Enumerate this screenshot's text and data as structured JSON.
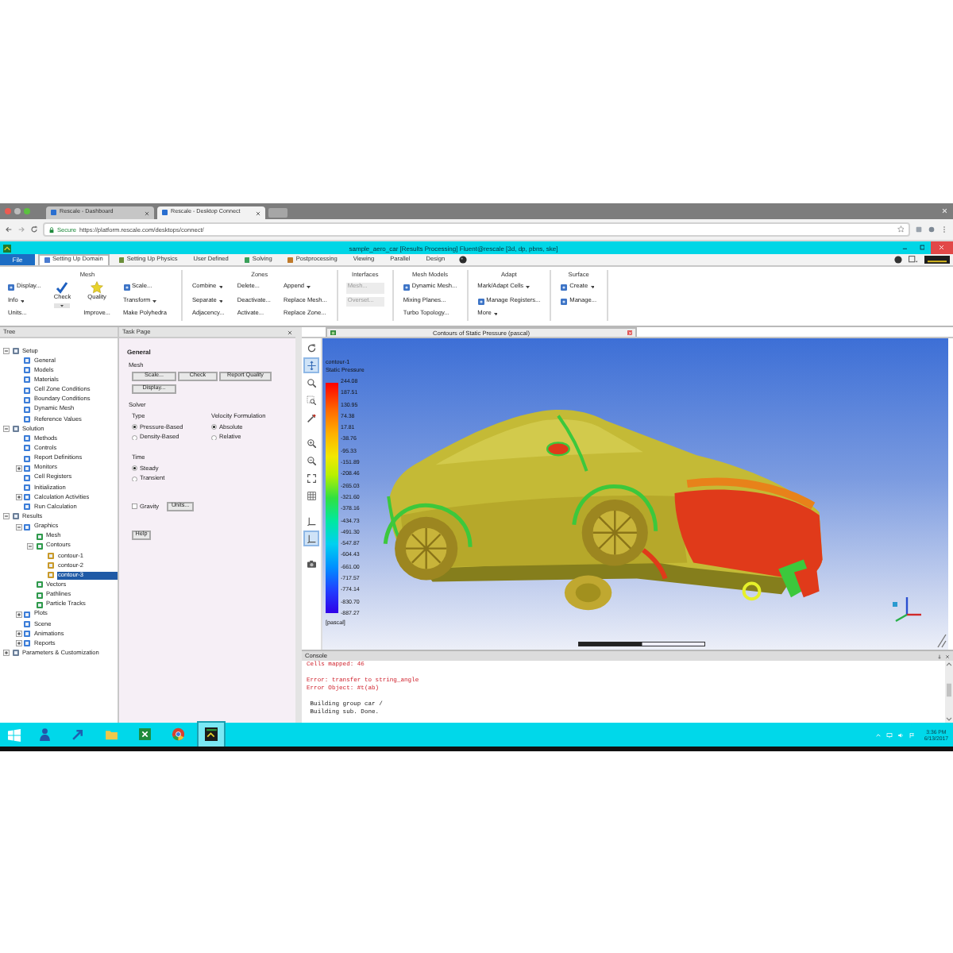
{
  "browser": {
    "tabs": [
      {
        "label": "Rescale - Dashboard",
        "selected": false
      },
      {
        "label": "Rescale - Desktop Connect",
        "selected": true
      }
    ],
    "secure_label": "Secure",
    "url": "https://platform.rescale.com/desktops/connect/"
  },
  "window": {
    "title": "sample_aero_car [Results Processing] Fluent@rescale [3d, dp, pbns, ske]"
  },
  "ribbon": {
    "file_label": "File",
    "tabs": [
      {
        "label": "Setting Up Domain",
        "kind": "icon",
        "selected": true
      },
      {
        "label": "Setting Up Physics",
        "kind": "icon",
        "selected": false
      },
      {
        "label": "User Defined",
        "kind": "plain",
        "selected": false
      },
      {
        "label": "Solving",
        "kind": "icon",
        "selected": false
      },
      {
        "label": "Postprocessing",
        "kind": "icon",
        "selected": false
      },
      {
        "label": "Viewing",
        "kind": "plain",
        "selected": false
      },
      {
        "label": "Parallel",
        "kind": "plain",
        "selected": false
      },
      {
        "label": "Design",
        "kind": "plain",
        "selected": false
      }
    ],
    "groups": [
      {
        "title": "Mesh",
        "columns": [
          [
            {
              "label": "Display...",
              "kind": "small",
              "menu": false,
              "disabled": false
            },
            {
              "label": "Info",
              "kind": "text",
              "menu": true,
              "disabled": false
            },
            {
              "label": "Units...",
              "kind": "text",
              "menu": false,
              "disabled": false
            }
          ],
          [
            {
              "label": "Check",
              "kind": "big",
              "menu": true,
              "disabled": false
            }
          ],
          [
            {
              "label": "Quality",
              "kind": "big",
              "menu": false,
              "disabled": false
            },
            {
              "label": "Improve...",
              "kind": "text",
              "menu": false,
              "disabled": false
            }
          ],
          [
            {
              "label": "Scale...",
              "kind": "small",
              "menu": false,
              "disabled": false
            },
            {
              "label": "Transform",
              "kind": "text",
              "menu": true,
              "disabled": false
            },
            {
              "label": "Make Polyhedra",
              "kind": "text",
              "menu": false,
              "disabled": false
            }
          ]
        ]
      },
      {
        "title": "Zones",
        "columns": [
          [
            {
              "label": "Combine",
              "kind": "text",
              "menu": true,
              "disabled": false
            },
            {
              "label": "Separate",
              "kind": "text",
              "menu": true,
              "disabled": false
            },
            {
              "label": "Adjacency...",
              "kind": "text",
              "menu": false,
              "disabled": false
            }
          ],
          [
            {
              "label": "Delete...",
              "kind": "text",
              "menu": false,
              "disabled": false
            },
            {
              "label": "Deactivate...",
              "kind": "text",
              "menu": false,
              "disabled": false
            },
            {
              "label": "Activate...",
              "kind": "text",
              "menu": false,
              "disabled": false
            }
          ],
          [
            {
              "label": "Append",
              "kind": "text",
              "menu": true,
              "disabled": false
            },
            {
              "label": "Replace Mesh...",
              "kind": "text",
              "menu": false,
              "disabled": false
            },
            {
              "label": "Replace Zone...",
              "kind": "text",
              "menu": false,
              "disabled": false
            }
          ]
        ]
      },
      {
        "title": "Interfaces",
        "columns": [
          [
            {
              "label": "Mesh...",
              "kind": "text",
              "menu": false,
              "disabled": true
            },
            {
              "label": "Overset...",
              "kind": "text",
              "menu": false,
              "disabled": true
            }
          ]
        ]
      },
      {
        "title": "Mesh Models",
        "columns": [
          [
            {
              "label": "Dynamic Mesh...",
              "kind": "small",
              "menu": false,
              "disabled": false
            },
            {
              "label": "Mixing Planes...",
              "kind": "text",
              "menu": false,
              "disabled": false
            },
            {
              "label": "Turbo Topology...",
              "kind": "text",
              "menu": false,
              "disabled": false
            }
          ]
        ]
      },
      {
        "title": "Adapt",
        "columns": [
          [
            {
              "label": "Mark/Adapt Cells",
              "kind": "text",
              "menu": true,
              "disabled": false
            },
            {
              "label": "Manage Registers...",
              "kind": "small",
              "menu": false,
              "disabled": false
            },
            {
              "label": "More",
              "kind": "text",
              "menu": true,
              "disabled": false
            }
          ]
        ]
      },
      {
        "title": "Surface",
        "columns": [
          [
            {
              "label": "Create",
              "kind": "small",
              "menu": true,
              "disabled": false
            },
            {
              "label": "Manage...",
              "kind": "small",
              "menu": false,
              "disabled": false
            }
          ]
        ]
      }
    ]
  },
  "tree": {
    "title": "Tree",
    "items": [
      {
        "label": "Setup",
        "expanded": true,
        "selected": false,
        "children": [
          {
            "label": "General",
            "selected": false
          },
          {
            "label": "Models",
            "selected": false
          },
          {
            "label": "Materials",
            "selected": false
          },
          {
            "label": "Cell Zone Conditions",
            "selected": false
          },
          {
            "label": "Boundary Conditions",
            "selected": false
          },
          {
            "label": "Dynamic Mesh",
            "selected": false
          },
          {
            "label": "Reference Values",
            "selected": false
          }
        ]
      },
      {
        "label": "Solution",
        "expanded": true,
        "selected": false,
        "children": [
          {
            "label": "Methods",
            "selected": false
          },
          {
            "label": "Controls",
            "selected": false
          },
          {
            "label": "Report Definitions",
            "selected": false
          },
          {
            "label": "Monitors",
            "expanded": false,
            "selected": false
          },
          {
            "label": "Cell Registers",
            "selected": false
          },
          {
            "label": "Initialization",
            "selected": false
          },
          {
            "label": "Calculation Activities",
            "expanded": false,
            "selected": false
          },
          {
            "label": "Run Calculation",
            "selected": false
          }
        ]
      },
      {
        "label": "Results",
        "expanded": true,
        "selected": false,
        "children": [
          {
            "label": "Graphics",
            "expanded": true,
            "selected": false,
            "children": [
              {
                "label": "Mesh",
                "selected": false
              },
              {
                "label": "Contours",
                "expanded": true,
                "selected": false,
                "children": [
                  {
                    "label": "contour-1",
                    "selected": false
                  },
                  {
                    "label": "contour-2",
                    "selected": false
                  },
                  {
                    "label": "contour-3",
                    "selected": true
                  }
                ]
              },
              {
                "label": "Vectors",
                "selected": false
              },
              {
                "label": "Pathlines",
                "selected": false
              },
              {
                "label": "Particle Tracks",
                "selected": false
              }
            ]
          },
          {
            "label": "Plots",
            "expanded": false,
            "selected": false
          },
          {
            "label": "Scene",
            "selected": false
          },
          {
            "label": "Animations",
            "expanded": false,
            "selected": false
          },
          {
            "label": "Reports",
            "expanded": false,
            "selected": false
          }
        ]
      },
      {
        "label": "Parameters & Customization",
        "expanded": false,
        "selected": false
      }
    ]
  },
  "task_page": {
    "title": "Task Page",
    "heading": "General",
    "mesh": {
      "label": "Mesh",
      "buttons": [
        "Scale...",
        "Check",
        "Report Quality",
        "Display..."
      ]
    },
    "solver": {
      "label": "Solver",
      "type": {
        "label": "Type",
        "options": [
          {
            "label": "Pressure-Based",
            "selected": true
          },
          {
            "label": "Density-Based",
            "selected": false
          }
        ]
      },
      "velocity_formulation": {
        "label": "Velocity Formulation",
        "options": [
          {
            "label": "Absolute",
            "selected": true
          },
          {
            "label": "Relative",
            "selected": false
          }
        ]
      },
      "time": {
        "label": "Time",
        "options": [
          {
            "label": "Steady",
            "selected": true
          },
          {
            "label": "Transient",
            "selected": false
          }
        ]
      }
    },
    "gravity": {
      "label": "Gravity",
      "checked": false
    },
    "units_button": "Units...",
    "help_button": "Help"
  },
  "viewport": {
    "title": "Contours of Static Pressure (pascal)",
    "tools": [
      {
        "selected": false
      },
      {
        "selected": true
      },
      {
        "selected": false
      },
      {
        "selected": false
      },
      {
        "selected": false
      },
      {
        "selected": false
      },
      {
        "selected": false
      },
      {
        "selected": false
      },
      {
        "selected": false
      },
      {
        "selected": false
      },
      {
        "selected": true
      },
      {
        "selected": false
      }
    ],
    "legend": {
      "title_lines": [
        "contour-1",
        "Static Pressure"
      ],
      "labels": [
        "244.08",
        "187.51",
        "130.95",
        "74.38",
        "17.81",
        "-38.76",
        "-95.33",
        "-151.89",
        "-208.46",
        "-265.03",
        "-321.60",
        "-378.16",
        "-434.73",
        "-491.30",
        "-547.87",
        "-604.43",
        "-661.00",
        "-717.57",
        "-774.14",
        "-830.70",
        "-887.27"
      ],
      "units": "[pascal]"
    }
  },
  "console": {
    "title": "Console",
    "lines": [
      {
        "text": "Cells mapped: 46",
        "kind": "error",
        "gap_before": false
      },
      {
        "text": "Error: transfer to string_angle",
        "kind": "error",
        "gap_before": true
      },
      {
        "text": "Error Object: #t(ab)",
        "kind": "error",
        "gap_before": false
      },
      {
        "text": " Building group car /",
        "kind": "info",
        "gap_before": true
      },
      {
        "text": " Building sub. Done.",
        "kind": "info",
        "gap_before": false
      }
    ]
  },
  "taskbar": {
    "apps": [
      {
        "selected": false
      },
      {
        "selected": false
      },
      {
        "selected": false
      },
      {
        "selected": false
      },
      {
        "selected": false
      },
      {
        "selected": true
      }
    ],
    "time": "3:36 PM",
    "date": "6/13/2017"
  }
}
